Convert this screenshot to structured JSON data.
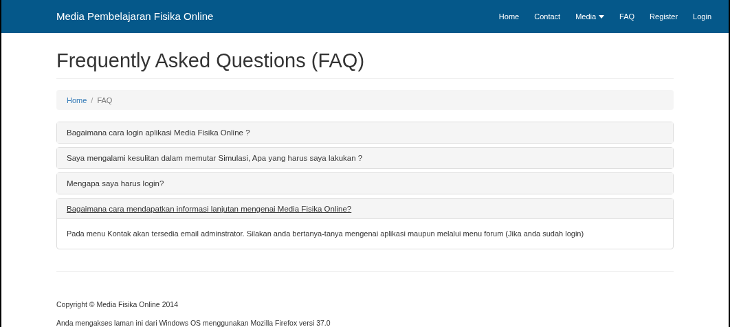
{
  "navbar": {
    "brand": "Media Pembelajaran Fisika Online",
    "items": [
      {
        "label": "Home",
        "kind": "link"
      },
      {
        "label": "Contact",
        "kind": "link"
      },
      {
        "label": "Media",
        "kind": "dropdown"
      },
      {
        "label": "FAQ",
        "kind": "link"
      },
      {
        "label": "Register",
        "kind": "link"
      },
      {
        "label": "Login",
        "kind": "link"
      }
    ]
  },
  "title": "Frequently Asked Questions (FAQ)",
  "breadcrumb_separator": "/",
  "breadcrumb": [
    {
      "label": "Home",
      "selected": false
    },
    {
      "label": "FAQ",
      "selected": true
    }
  ],
  "faq": [
    {
      "question": "Bagaimana cara login aplikasi Media Fisika Online ?",
      "expanded": false
    },
    {
      "question": "Saya mengalami kesulitan dalam memutar Simulasi, Apa yang harus saya lakukan ?",
      "expanded": false
    },
    {
      "question": "Mengapa saya harus login?",
      "expanded": false
    },
    {
      "question": "Bagaimana cara mendapatkan informasi lanjutan mengenai Media Fisika Online?",
      "expanded": true,
      "answer": "Pada menu Kontak akan tersedia email adminstrator. Silakan anda bertanya-tanya mengenai aplikasi maupun melalui menu forum (Jika anda sudah login)"
    }
  ],
  "footer": [
    "Copyright © Media Fisika Online 2014",
    "Anda mengakses laman ini dari Windows OS menggunakan Mozilla Firefox versi 37.0"
  ]
}
